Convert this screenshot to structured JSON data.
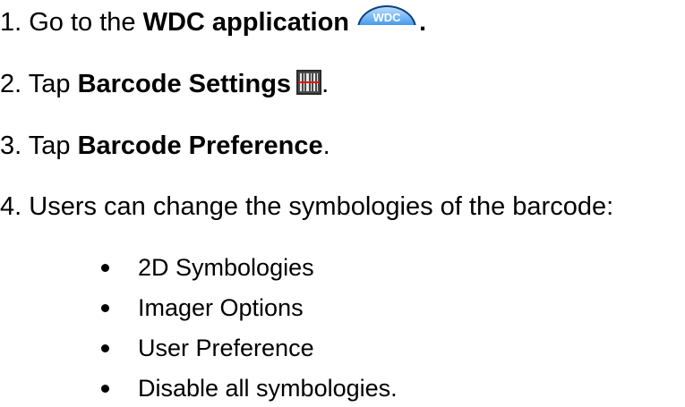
{
  "steps": [
    {
      "number": "1.",
      "text_before": "Go to the ",
      "bold": "WDC application",
      "text_after": ".",
      "icon": {
        "name": "wdc-app-icon",
        "label": "WDC",
        "color": "#1d7fd4"
      }
    },
    {
      "number": "2.",
      "text_before": "Tap ",
      "bold": "Barcode Settings",
      "text_after": ".",
      "icon": {
        "name": "barcode-settings-icon",
        "color": "#cc1a1a"
      }
    },
    {
      "number": "3.",
      "text_before": "Tap ",
      "bold": "Barcode Preference",
      "text_after": "."
    },
    {
      "number": "4.",
      "text": "Users can change the symbologies of the barcode:"
    }
  ],
  "options": [
    "2D Symbologies",
    "Imager Options",
    "User Preference",
    "Disable all symbologies."
  ]
}
